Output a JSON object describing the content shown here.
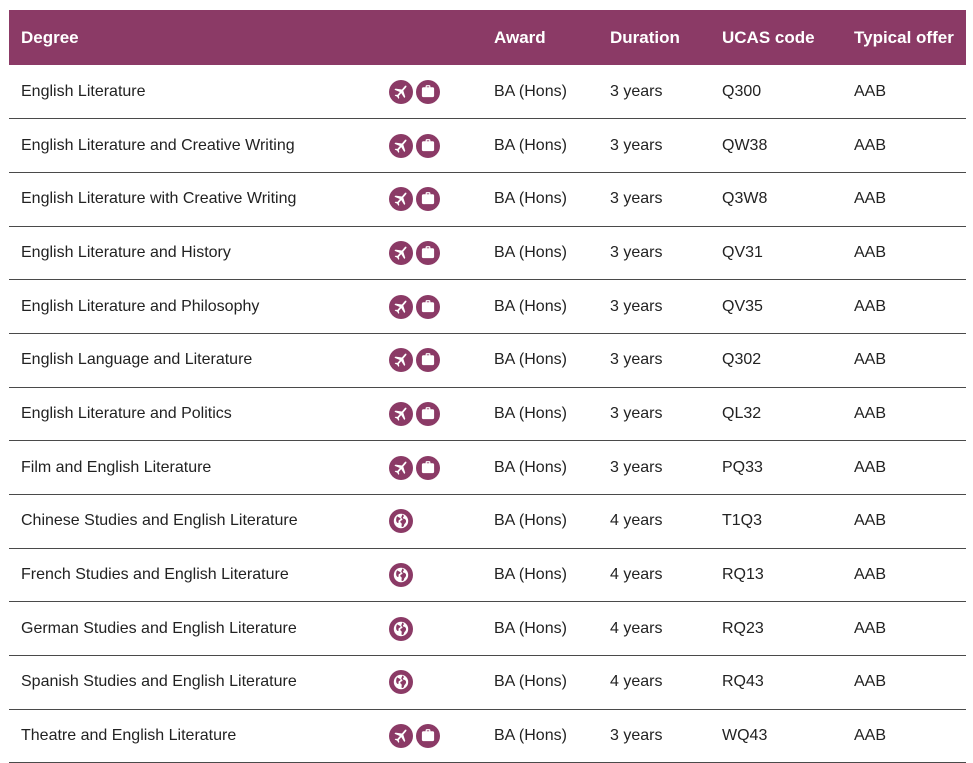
{
  "table": {
    "headers": {
      "degree": "Degree",
      "award": "Award",
      "duration": "Duration",
      "ucas": "UCAS code",
      "offer": "Typical offer"
    },
    "rows": [
      {
        "degree": "English Literature",
        "icons": [
          "plane-icon",
          "briefcase-icon"
        ],
        "award": "BA (Hons)",
        "duration": "3 years",
        "ucas": "Q300",
        "offer": "AAB"
      },
      {
        "degree": "English Literature and Creative Writing",
        "icons": [
          "plane-icon",
          "briefcase-icon"
        ],
        "award": "BA (Hons)",
        "duration": "3 years",
        "ucas": "QW38",
        "offer": "AAB"
      },
      {
        "degree": "English Literature with Creative Writing",
        "icons": [
          "plane-icon",
          "briefcase-icon"
        ],
        "award": "BA (Hons)",
        "duration": "3 years",
        "ucas": "Q3W8",
        "offer": "AAB"
      },
      {
        "degree": "English Literature and History",
        "icons": [
          "plane-icon",
          "briefcase-icon"
        ],
        "award": "BA (Hons)",
        "duration": "3 years",
        "ucas": "QV31",
        "offer": "AAB"
      },
      {
        "degree": "English Literature and Philosophy",
        "icons": [
          "plane-icon",
          "briefcase-icon"
        ],
        "award": "BA (Hons)",
        "duration": "3 years",
        "ucas": "QV35",
        "offer": "AAB"
      },
      {
        "degree": "English Language and Literature",
        "icons": [
          "plane-icon",
          "briefcase-icon"
        ],
        "award": "BA (Hons)",
        "duration": "3 years",
        "ucas": "Q302",
        "offer": "AAB"
      },
      {
        "degree": "English Literature and Politics",
        "icons": [
          "plane-icon",
          "briefcase-icon"
        ],
        "award": "BA (Hons)",
        "duration": "3 years",
        "ucas": "QL32",
        "offer": "AAB"
      },
      {
        "degree": "Film and English Literature",
        "icons": [
          "plane-icon",
          "briefcase-icon"
        ],
        "award": "BA (Hons)",
        "duration": "3 years",
        "ucas": "PQ33",
        "offer": "AAB"
      },
      {
        "degree": "Chinese Studies and English Literature",
        "icons": [
          "globe-icon"
        ],
        "award": "BA (Hons)",
        "duration": "4 years",
        "ucas": "T1Q3",
        "offer": "AAB"
      },
      {
        "degree": "French Studies and English Literature",
        "icons": [
          "globe-icon"
        ],
        "award": "BA (Hons)",
        "duration": "4 years",
        "ucas": "RQ13",
        "offer": "AAB"
      },
      {
        "degree": "German Studies and English Literature",
        "icons": [
          "globe-icon"
        ],
        "award": "BA (Hons)",
        "duration": "4 years",
        "ucas": "RQ23",
        "offer": "AAB"
      },
      {
        "degree": "Spanish Studies and English Literature",
        "icons": [
          "globe-icon"
        ],
        "award": "BA (Hons)",
        "duration": "4 years",
        "ucas": "RQ43",
        "offer": "AAB"
      },
      {
        "degree": "Theatre and English Literature",
        "icons": [
          "plane-icon",
          "briefcase-icon"
        ],
        "award": "BA (Hons)",
        "duration": "3 years",
        "ucas": "WQ43",
        "offer": "AAB"
      }
    ]
  },
  "colors": {
    "header_bg": "#8b3a66",
    "header_text": "#ffffff",
    "icon_bg": "#8b3a66",
    "row_divider": "#4a4a4a"
  }
}
